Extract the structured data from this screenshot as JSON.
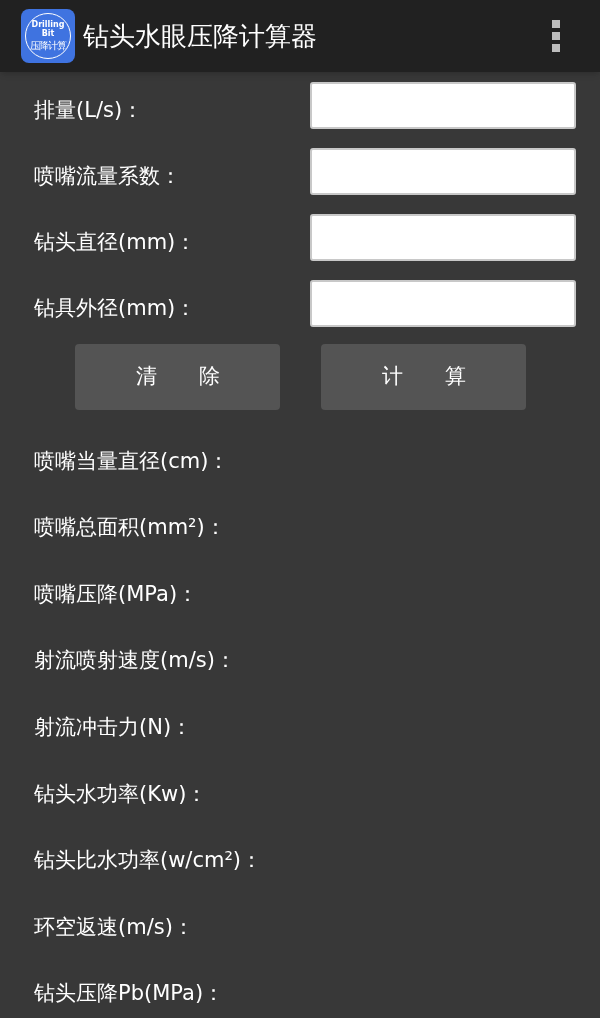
{
  "app_bar": {
    "icon_text": [
      "Drilling",
      "Bit",
      "压降计算"
    ],
    "title": "钻头水眼压降计算器"
  },
  "inputs": [
    {
      "label": "排量(L/s)："
    },
    {
      "label": "喷嘴流量系数："
    },
    {
      "label": "钻头直径(mm)："
    },
    {
      "label": "钻具外径(mm)："
    }
  ],
  "buttons": [
    "清　　除",
    "计　　算"
  ],
  "results": [
    "喷嘴当量直径(cm)：",
    "喷嘴总面积(mm²)：",
    "喷嘴压降(MPa)：",
    "射流喷射速度(m/s)：",
    "射流冲击力(N)：",
    "钻头水功率(Kw)：",
    "钻头比水功率(w/cm²)：",
    "环空返速(m/s)：",
    "钻头压降Pb(MPa)："
  ]
}
